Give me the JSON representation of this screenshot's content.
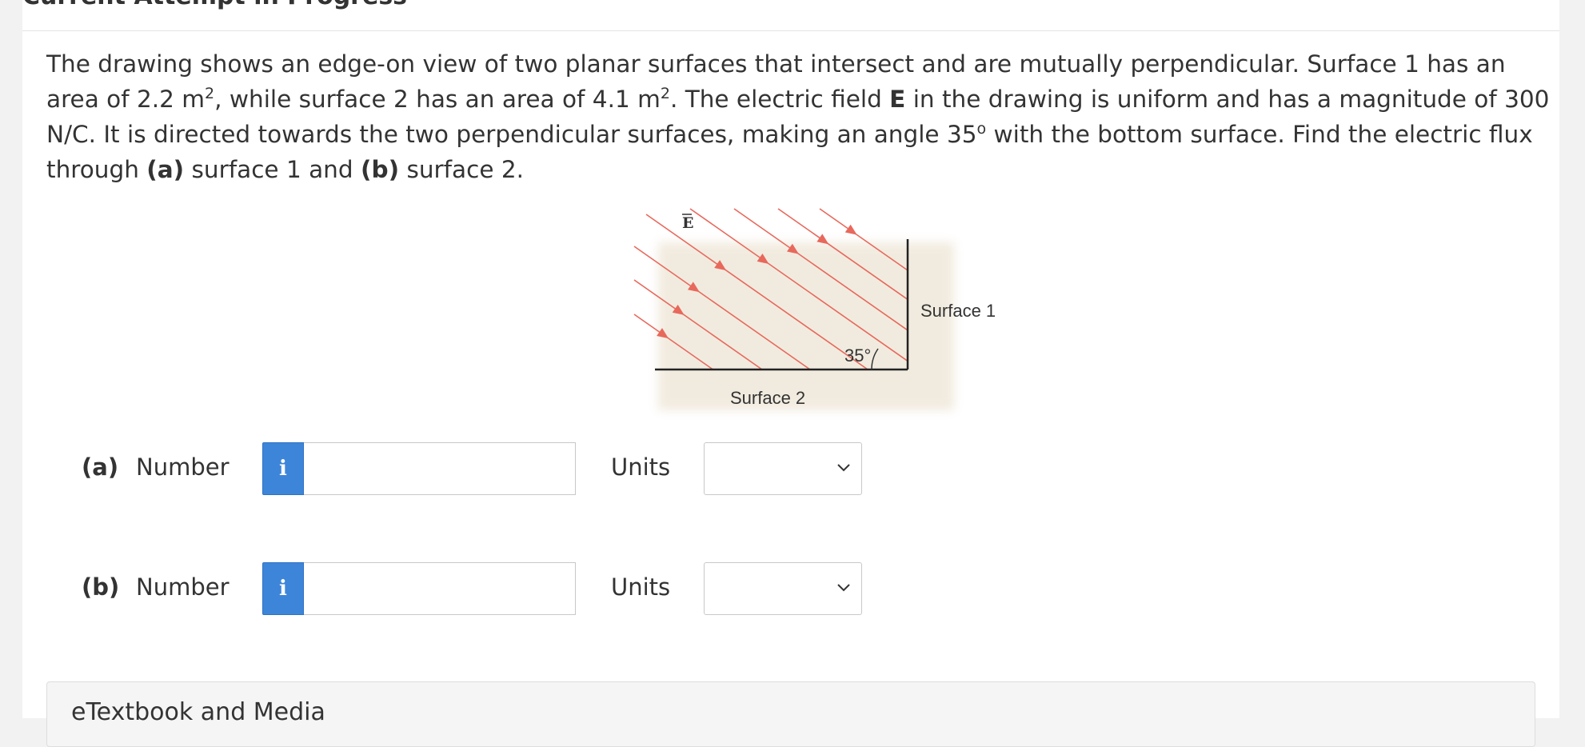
{
  "header": {
    "title": "Current Attempt in Progress"
  },
  "question": {
    "text_1": "The drawing shows an edge-on view of two planar surfaces that intersect and are mutually perpendicular. Surface 1 has an area of 2.2 m",
    "sup_1": "2",
    "text_2": ", while surface 2 has an area of 4.1 m",
    "sup_2": "2",
    "text_3": ". The electric field ",
    "bold_field": "E",
    "text_4": " in the drawing is uniform and has a magnitude of 300 N/C. It is directed towards the two perpendicular surfaces, making an angle 35",
    "sup_deg": "o",
    "text_5": " with the bottom surface. Find the electric flux through ",
    "bold_a": "(a)",
    "text_6": " surface 1 and ",
    "bold_b": "(b)",
    "text_7": " surface 2."
  },
  "figure": {
    "field_label": "E",
    "surface1_label": "Surface 1",
    "surface2_label": "Surface 2",
    "angle_label": "35°",
    "line_color": "#e8685c",
    "surface_color": "#222222"
  },
  "answers": [
    {
      "part": "(a)",
      "number_label": "Number",
      "info_icon": "i",
      "value": "",
      "units_label": "Units",
      "units_selected": ""
    },
    {
      "part": "(b)",
      "number_label": "Number",
      "info_icon": "i",
      "value": "",
      "units_label": "Units",
      "units_selected": ""
    }
  ],
  "etextbook": {
    "label": "eTextbook and Media"
  },
  "colors": {
    "info_button": "#3d85d9",
    "page_background": "#f2f2f2"
  }
}
